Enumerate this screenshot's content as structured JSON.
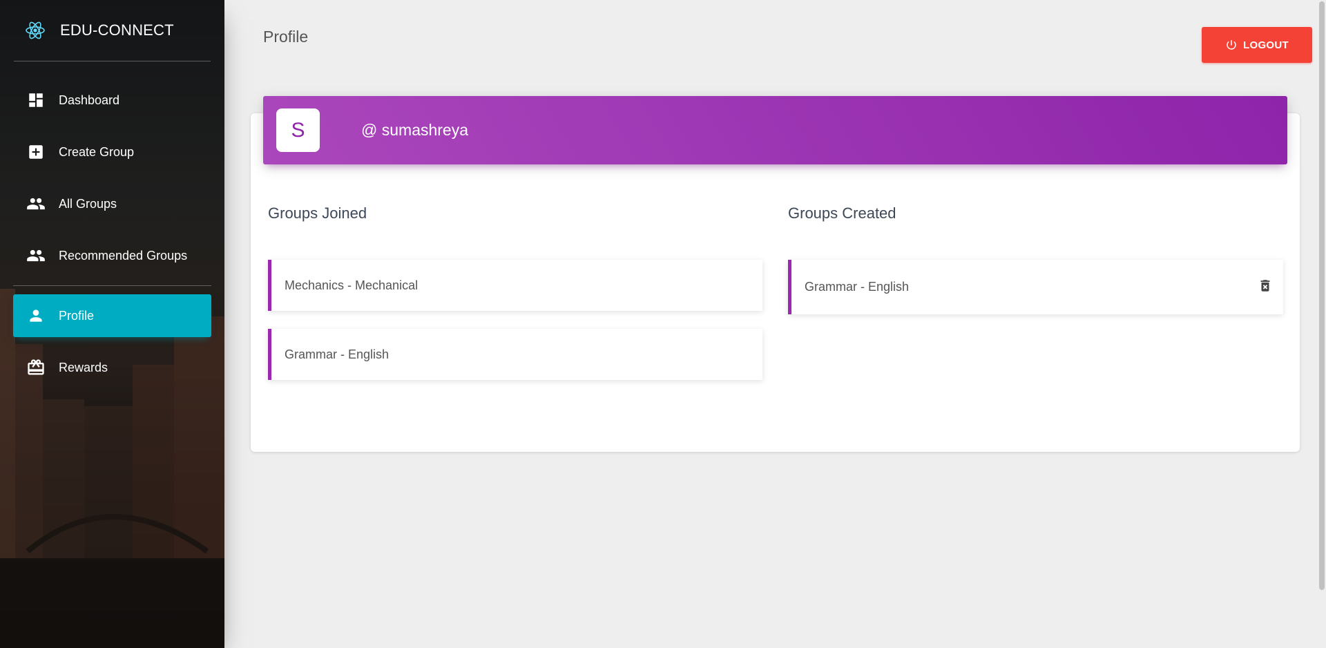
{
  "app": {
    "brand": "EDU-CONNECT"
  },
  "sidebar": {
    "items": [
      {
        "label": "Dashboard",
        "icon": "dashboard-icon"
      },
      {
        "label": "Create Group",
        "icon": "add-box-icon"
      },
      {
        "label": "All Groups",
        "icon": "people-icon"
      },
      {
        "label": "Recommended Groups",
        "icon": "people-icon"
      },
      {
        "label": "Profile",
        "icon": "person-icon",
        "active": true
      },
      {
        "label": "Rewards",
        "icon": "card-giftcard-icon"
      }
    ]
  },
  "header": {
    "title": "Profile",
    "logout_label": "LOGOUT"
  },
  "profile": {
    "avatar_letter": "S",
    "username": "@ sumashreya"
  },
  "groups_joined": {
    "title": "Groups Joined",
    "items": [
      "Mechanics - Mechanical",
      "Grammar - English"
    ]
  },
  "groups_created": {
    "title": "Groups Created",
    "items": [
      "Grammar - English"
    ]
  },
  "colors": {
    "accent_purple": "#9c27b0",
    "active_nav": "#00acc1",
    "logout_red": "#f44336"
  }
}
